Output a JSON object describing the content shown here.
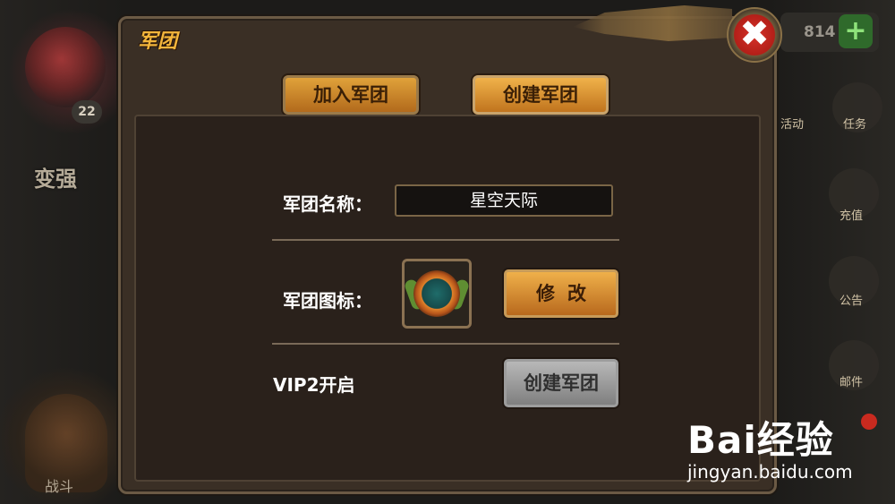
{
  "hud": {
    "level": "22",
    "strengthen_label": "变强",
    "fight_label": "战斗",
    "coins": "814",
    "add_label": "+",
    "side_labels": [
      "活动",
      "任务",
      "充值",
      "公告",
      "邮件"
    ]
  },
  "dialog": {
    "title": "军团",
    "close_label": "✖",
    "tabs": [
      {
        "label": "加入军团"
      },
      {
        "label": "创建军团"
      }
    ],
    "name_label": "军团名称：",
    "name_value": "星空天际",
    "icon_label": "军团图标：",
    "modify_button": "修改",
    "vip_label": "VIP2开启",
    "create_button": "创建军团"
  },
  "watermark": {
    "logo": "Bai经验",
    "url": "jingyan.baidu.com"
  },
  "colors": {
    "title": "#f3b63c",
    "button_orange": "#e0a23a",
    "button_disabled": "#9d9d9d",
    "close_red": "#d6322a"
  }
}
